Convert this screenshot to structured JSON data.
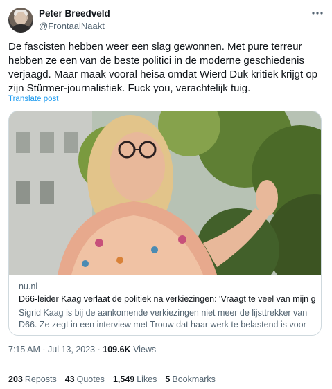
{
  "post": {
    "author_name": "Peter Breedveld",
    "author_handle": "@FrontaalNaakt",
    "more_icon": "more-horizontal-icon",
    "text": "De fascisten hebben weer een slag gewonnen. Met pure terreur hebben ze een van de beste politici in de moderne geschiedenis verjaagd. Maar maak vooral heisa omdat Wierd Duk kritiek krijgt op zijn Stürmer-journalistiek. Fuck you, verachtelijk tuig.",
    "translate_label": "Translate post"
  },
  "card": {
    "domain": "nu.nl",
    "title": "D66-leider Kaag verlaat de politiek na verkiezingen: 'Vraagt te veel van mijn g...",
    "description": "Sigrid Kaag is bij de aankomende verkiezingen niet meer de lijsttrekker van D66. Ze zegt in een interview met Trouw dat haar werk te belastend is voor ..."
  },
  "meta": {
    "time": "7:15 AM",
    "separator": "·",
    "date": "Jul 13, 2023",
    "views_count": "109.6K",
    "views_label": "Views"
  },
  "stats": {
    "reposts_count": "203",
    "reposts_label": "Reposts",
    "quotes_count": "43",
    "quotes_label": "Quotes",
    "likes_count": "1,549",
    "likes_label": "Likes",
    "bookmarks_count": "5",
    "bookmarks_label": "Bookmarks"
  },
  "colors": {
    "text": "#0f1419",
    "secondary": "#536471",
    "link": "#1d9bf0",
    "border": "#cfd9de"
  }
}
